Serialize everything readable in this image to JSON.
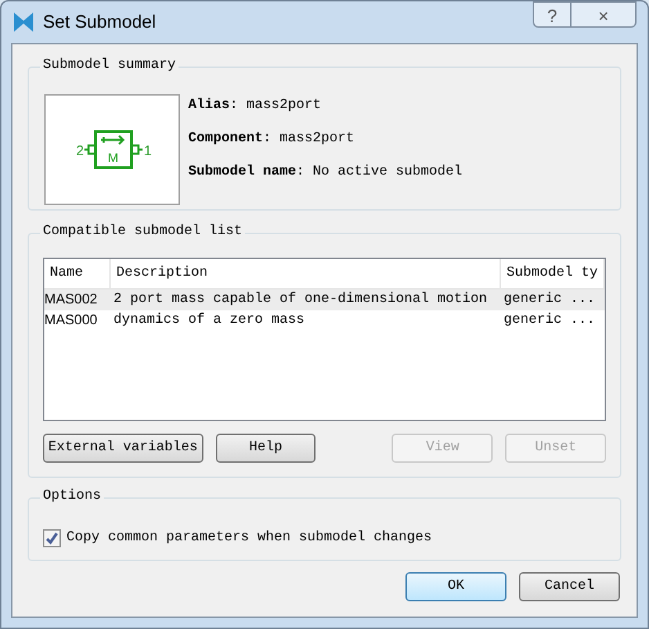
{
  "window": {
    "title": "Set Submodel",
    "title_buttons": [
      "?",
      "×"
    ]
  },
  "summary": {
    "title": "Submodel summary",
    "diagram": {
      "left_port": "2",
      "right_port": "1",
      "label": "M"
    },
    "fields": [
      "**Alias**: mass2port",
      "**Component**: mass2port",
      "**Submodel name**: No active submodel"
    ]
  },
  "list": {
    "title": "Compatible submodel list",
    "columns": [
      "Name",
      "Description",
      "Submodel ty"
    ],
    "rows": [
      {
        "cells": [
          "MAS002",
          "2 port mass capable of one-dimensional motion",
          "generic ..."
        ],
        "selected": true
      },
      {
        "cells": [
          "MAS000",
          "dynamics of a zero mass",
          "generic ..."
        ],
        "selected": false
      }
    ],
    "buttons": [
      {
        "label": "External variables",
        "disabled": false
      },
      {
        "label": "Help",
        "disabled": false
      },
      {
        "label": "View",
        "disabled": true
      },
      {
        "label": "Unset",
        "disabled": true
      }
    ]
  },
  "options": {
    "title": "Options",
    "checkbox": {
      "label": "Copy common parameters when submodel changes",
      "checked": true
    }
  },
  "buttons": [
    {
      "label": "OK",
      "default": true
    },
    {
      "label": "Cancel",
      "default": false
    }
  ]
}
